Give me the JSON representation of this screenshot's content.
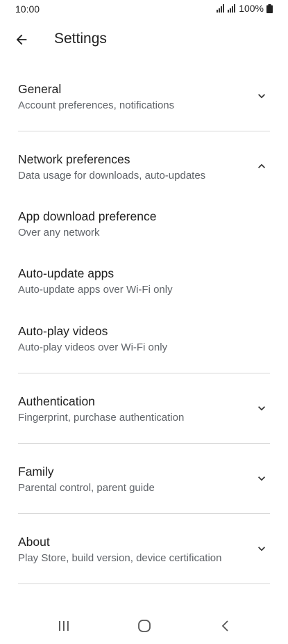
{
  "status_bar": {
    "time": "10:00",
    "battery": "100%",
    "icons": [
      "signal-icon",
      "signal-icon",
      "battery-icon"
    ]
  },
  "header": {
    "title": "Settings",
    "back_icon": "arrow-back-icon"
  },
  "sections": [
    {
      "title": "General",
      "subtitle": "Account preferences, notifications",
      "expanded": false
    },
    {
      "title": "Network preferences",
      "subtitle": "Data usage for downloads, auto-updates",
      "expanded": true,
      "items": [
        {
          "title": "App download preference",
          "subtitle": "Over any network"
        },
        {
          "title": "Auto-update apps",
          "subtitle": "Auto-update apps over Wi-Fi only"
        },
        {
          "title": "Auto-play videos",
          "subtitle": "Auto-play videos over Wi-Fi only"
        }
      ]
    },
    {
      "title": "Authentication",
      "subtitle": "Fingerprint, purchase authentication",
      "expanded": false
    },
    {
      "title": "Family",
      "subtitle": "Parental control, parent guide",
      "expanded": false
    },
    {
      "title": "About",
      "subtitle": "Play Store, build version, device certification",
      "expanded": false
    }
  ],
  "nav_bar": {
    "icons": [
      "recent-apps-icon",
      "home-icon",
      "back-icon"
    ]
  }
}
